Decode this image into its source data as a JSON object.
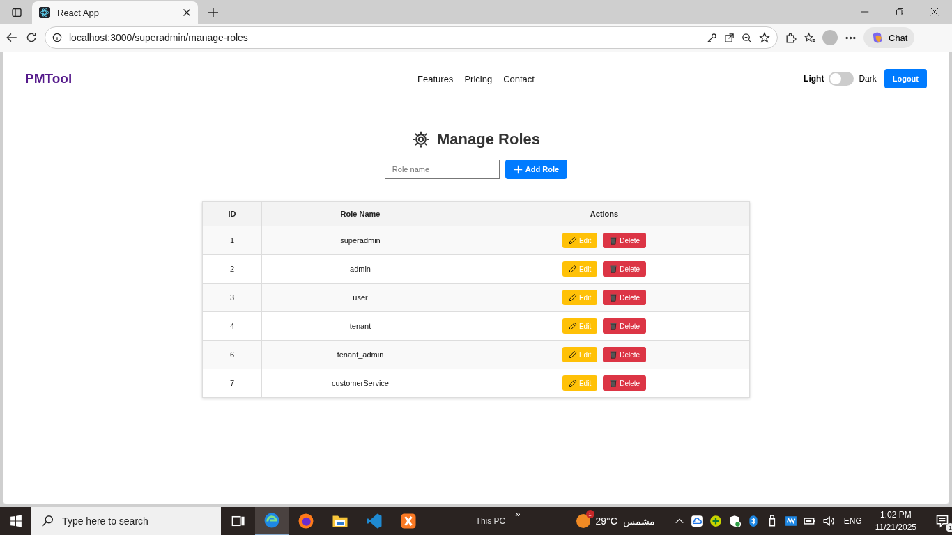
{
  "browser": {
    "tab_title": "React App",
    "address": "localhost:3000/superadmin/manage-roles",
    "chat_label": "Chat"
  },
  "navbar": {
    "logo": "PMTool",
    "links": [
      "Features",
      "Pricing",
      "Contact"
    ],
    "theme_light": "Light",
    "theme_dark": "Dark",
    "dark_mode": false,
    "logout": "Logout"
  },
  "heading": "Manage Roles",
  "role_input": {
    "placeholder": "Role name"
  },
  "add_button": "Add Role",
  "table": {
    "columns": [
      "ID",
      "Role Name",
      "Actions"
    ],
    "rows": [
      {
        "id": "1",
        "name": "superadmin",
        "edit": "Edit",
        "delete": "Delete"
      },
      {
        "id": "2",
        "name": "admin",
        "edit": "Edit",
        "delete": "Delete"
      },
      {
        "id": "3",
        "name": "user",
        "edit": "Edit",
        "delete": "Delete"
      },
      {
        "id": "4",
        "name": "tenant",
        "edit": "Edit",
        "delete": "Delete"
      },
      {
        "id": "6",
        "name": "tenant_admin",
        "edit": "Edit",
        "delete": "Delete"
      },
      {
        "id": "7",
        "name": "customerService",
        "edit": "Edit",
        "delete": "Delete"
      }
    ]
  },
  "taskbar": {
    "search_placeholder": "Type here to search",
    "this_pc": "This PC",
    "more": "»",
    "weather_badge": "1",
    "temperature": "29°C",
    "condition": "مشمس",
    "language": "ENG",
    "time": "1:02 PM",
    "date": "11/21/2025",
    "notifications": "1"
  }
}
